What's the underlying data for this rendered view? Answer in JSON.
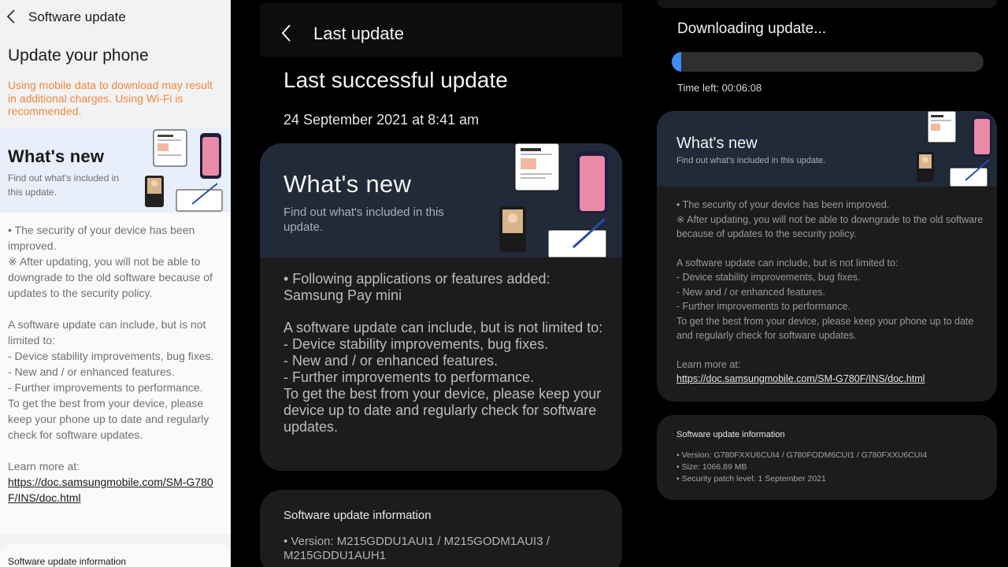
{
  "panel_light": {
    "header_title": "Software update",
    "page_heading": "Update your phone",
    "data_warning": "Using mobile data to download may result in additional charges. Using Wi-Fi is recommended.",
    "whats_new": {
      "title": "What's new",
      "subtitle": "Find out what's included in this update."
    },
    "description": [
      "• The security of your device has been improved.",
      "※ After updating, you will not be able to downgrade to the old software because of updates to the security policy.",
      "",
      "A software update can include, but is not limited to:",
      " - Device stability improvements, bug fixes.",
      " - New and / or enhanced features.",
      " - Further improvements to performance.",
      "To get the best from your device, please keep your phone up to date and regularly check for software updates.",
      "",
      "Learn more at:"
    ],
    "learn_more_link": "https://doc.samsungmobile.com/SM-G780F/INS/doc.html",
    "info_title": "Software update information"
  },
  "panel_last_update": {
    "header_title": "Last update",
    "page_heading": "Last successful update",
    "date": "24 September 2021 at 8:41 am",
    "whats_new": {
      "title": "What's new",
      "subtitle": "Find out what's included in this update."
    },
    "description": [
      "• Following applications or features added:",
      "Samsung Pay mini",
      "",
      "A software update can include, but is not limited to:",
      " - Device stability improvements, bug fixes.",
      " - New and / or enhanced features.",
      " - Further improvements to performance.",
      "To get the best from your device, please keep your device up to date and regularly check for software updates."
    ],
    "info_title": "Software update information",
    "info_lines": [
      "• Version: M215GDDU1AUI1 / M215GODM1AUI3 / M215GDDU1AUH1"
    ]
  },
  "panel_downloading": {
    "status_title": "Downloading update...",
    "progress_percent": 3,
    "time_left": "Time left: 00:06:08",
    "whats_new": {
      "title": "What's new",
      "subtitle": "Find out what's included in this update."
    },
    "description": [
      "• The security of your device has been improved.",
      "※ After updating, you will not be able to downgrade to the old software because of updates to the security policy.",
      "",
      "A software update can include, but is not limited to:",
      " - Device stability improvements, bug fixes.",
      " - New and / or enhanced features.",
      " - Further improvements to performance.",
      "To get the best from your device, please keep your phone up to date and regularly check for software updates.",
      "",
      "Learn more at:"
    ],
    "learn_more_link": "https://doc.samsungmobile.com/SM-G780F/INS/doc.html",
    "info_title": "Software update information",
    "info_lines": [
      "• Version: G780FXXU6CUI4 / G780FODM6CUI1 / G780FXXU6CUI4",
      "• Size: 1066.89 MB",
      "• Security patch level: 1 September 2021"
    ]
  },
  "colors": {
    "accent_blue": "#3e8cf5",
    "warning_orange": "#f0883e",
    "dark_card": "#1c1c1c",
    "whats_new_dark": "#212a38",
    "whats_new_light": "#e8effa"
  },
  "icons": [
    "back-arrow-icon",
    "whats-new-illustration"
  ]
}
